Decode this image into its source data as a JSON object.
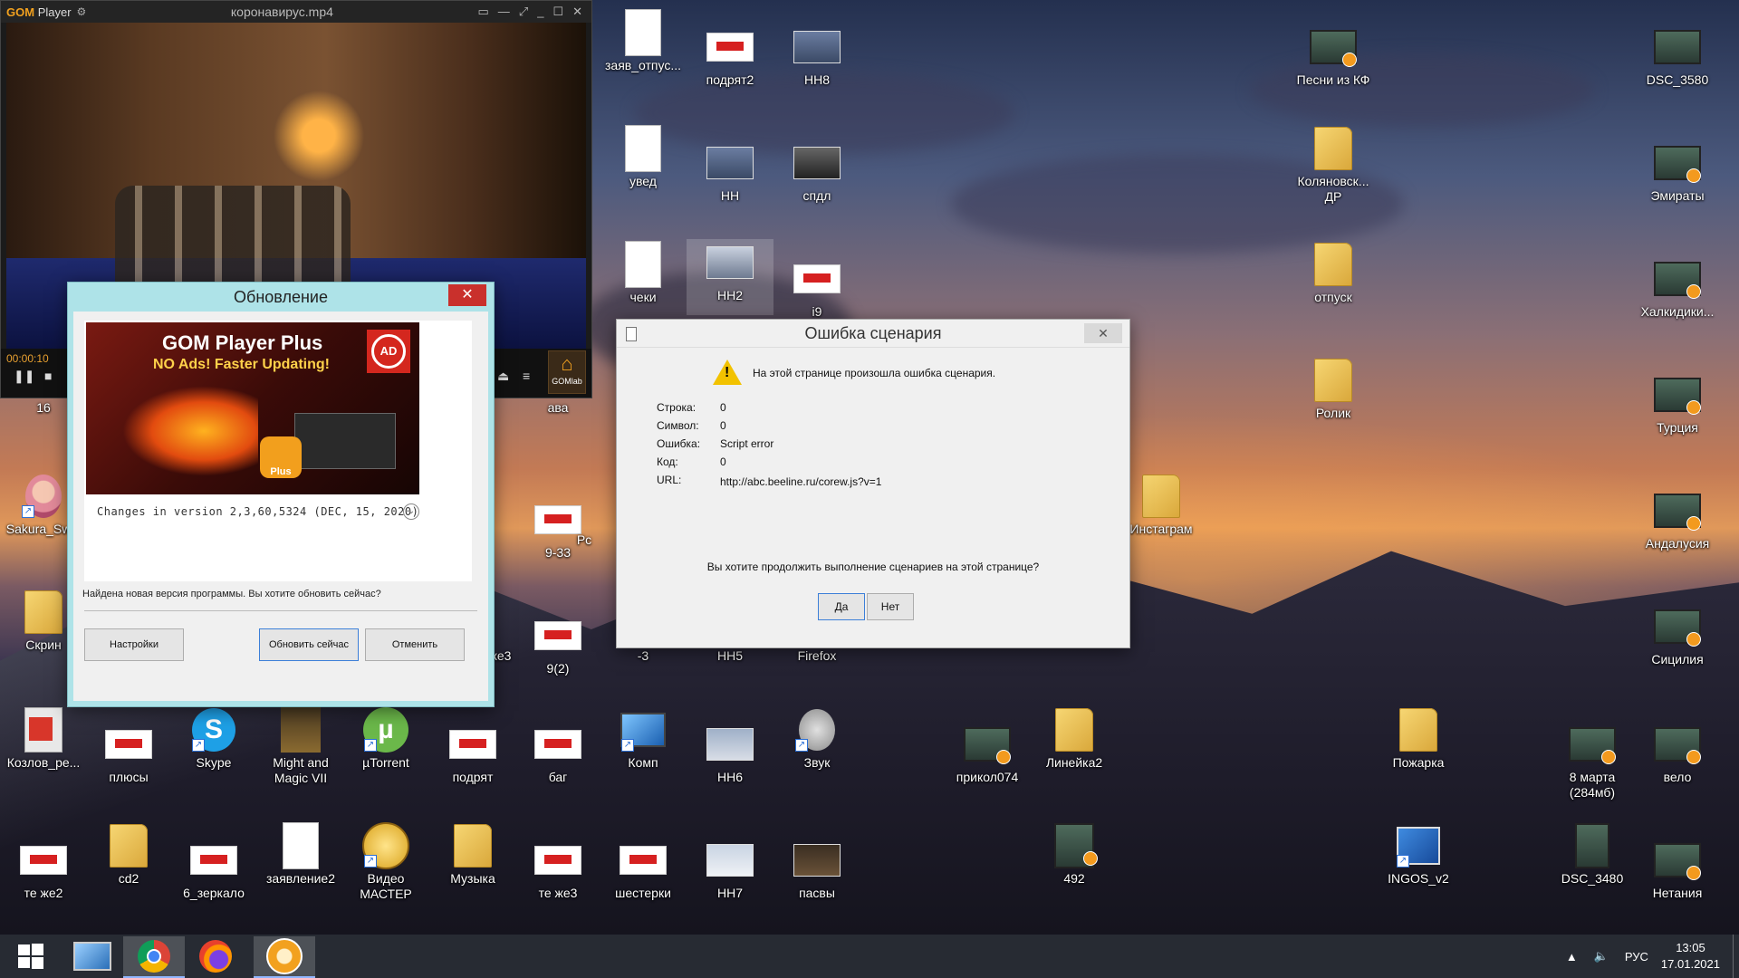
{
  "gom": {
    "logo": "GOM",
    "logo_suffix": "Player",
    "title": "коронавирус.mp4",
    "time": "00:00:10",
    "lab_label": "GOMlab"
  },
  "update": {
    "title": "Обновление",
    "banner_title": "GOM Player Plus",
    "banner_sub": "NO Ads! Faster Updating!",
    "banner_noads": "AD",
    "banner_plus": "Plus",
    "changes": "Changes in version 2,3,60,5324 (DEC, 15, 2020)",
    "message": "Найдена новая версия программы. Вы хотите обновить сейчас?",
    "btn_settings": "Настройки",
    "btn_update": "Обновить сейчас",
    "btn_cancel": "Отменить"
  },
  "error": {
    "title": "Ошибка сценария",
    "headline": "На этой странице произошла ошибка сценария.",
    "rows": [
      {
        "label": "Строка:",
        "value": "0"
      },
      {
        "label": "Символ:",
        "value": "0"
      },
      {
        "label": "Ошибка:",
        "value": "Script error"
      },
      {
        "label": "Код:",
        "value": "0"
      },
      {
        "label": "URL:",
        "value": "http://abc.beeline.ru/corew.js?v=1"
      }
    ],
    "question": "Вы хотите продолжить выполнение сценариев на этой странице?",
    "btn_yes": "Да",
    "btn_no": "Нет"
  },
  "desktop_icons": {
    "zayav_otpusk": "заяв_отпус...",
    "podryat2": "подрят2",
    "nn8": "НН8",
    "pesni_kf": "Песни из КФ",
    "dsc_3580": "DSC_3580",
    "uved": "увед",
    "nn": "НН",
    "spdl": "спдл",
    "kolyanovsk": "Коляновск... ДР",
    "emiraty": "Эмираты",
    "cheki": "чеки",
    "nn2": "НН2",
    "i9": "i9",
    "otpusk": "отпуск",
    "halkidiki": "Халкидики...",
    "n16": "16",
    "ava": "ава",
    "rolik": "Ролик",
    "turciya": "Турция",
    "sakura": "Sakura_Sw...",
    "n9_33": "9-33",
    "pc": "Pc",
    "instagram": "Инстаграм",
    "andalusia": "Андалусия",
    "skrin": "Скрин",
    "je3": "же3",
    "n9_2": "9(2)",
    "minus3": "-3",
    "nn5": "НН5",
    "firefox": "Firefox",
    "sicilia": "Сицилия",
    "kozlov": "Козлов_ре...",
    "plyusy": "плюсы",
    "skype": "Skype",
    "might_magic": "Might and Magic VII",
    "utorrent": "µTorrent",
    "podryat": "подрят",
    "bag": "баг",
    "komp": "Комп",
    "nn6": "НН6",
    "zvuk": "Звук",
    "prikol074": "прикол074",
    "lineyka2": "Линейка2",
    "pozharka": "Пожарка",
    "march8": "8 марта (284мб)",
    "velo": "вело",
    "te_zhe2": "те же2",
    "cd2": "cd2",
    "zerkalo6": "6_зеркало",
    "zayavlenie2": "заявление2",
    "video_master": "Видео МАСТЕР",
    "muzyka": "Музыка",
    "te_zhe3": "те же3",
    "shesterki": "шестерки",
    "nn7": "НН7",
    "pasvy": "пасвы",
    "n492": "492",
    "ingos": "INGOS_v2",
    "dsc_3480": "DSC_3480",
    "netaniya": "Нетания"
  },
  "taskbar": {
    "lang": "РУС",
    "time": "13:05",
    "date": "17.01.2021"
  },
  "colors": {
    "gom_accent": "#f2a11f",
    "update_frame": "#aee3e8",
    "close_red": "#c9302c",
    "warn_yellow": "#f2c200"
  }
}
